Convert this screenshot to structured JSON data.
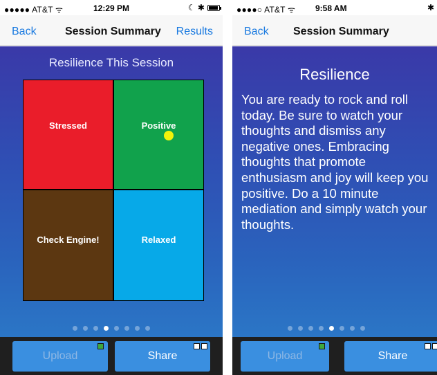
{
  "left": {
    "status": {
      "carrier": "●●●●● AT&T ᯤ",
      "time": "12:29 PM",
      "icons": "☾ ✱"
    },
    "nav": {
      "back": "Back",
      "title": "Session Summary",
      "right": "Results"
    },
    "session_title": "Resilience This Session",
    "quadrants": {
      "stressed": "Stressed",
      "positive": "Positive",
      "check_engine": "Check Engine!",
      "relaxed": "Relaxed"
    },
    "page_dots": {
      "count": 8,
      "active_index": 3
    },
    "buttons": {
      "upload": "Upload",
      "share": "Share"
    }
  },
  "right": {
    "status": {
      "carrier": "●●●●○ AT&T ᯤ",
      "time": "9:58 AM",
      "icons": "✱"
    },
    "nav": {
      "back": "Back",
      "title": "Session Summary"
    },
    "resilience_title": "Resilience",
    "resilience_text": "You are ready to rock and roll today. Be sure to watch your thoughts and dismiss any negative ones. Embracing thoughts that promote enthusiasm and joy will keep you positive. Do a 10 minute mediation and simply watch your thoughts.",
    "page_dots": {
      "count": 8,
      "active_index": 4
    },
    "buttons": {
      "upload": "Upload",
      "share": "Share"
    }
  },
  "colors": {
    "accent": "#1a7ae0",
    "stressed": "#ea1d2a",
    "positive": "#11a24c",
    "check_engine": "#5c3711",
    "relaxed": "#07a9e8",
    "marker": "#f2f20a",
    "button": "#3a8fe0"
  }
}
